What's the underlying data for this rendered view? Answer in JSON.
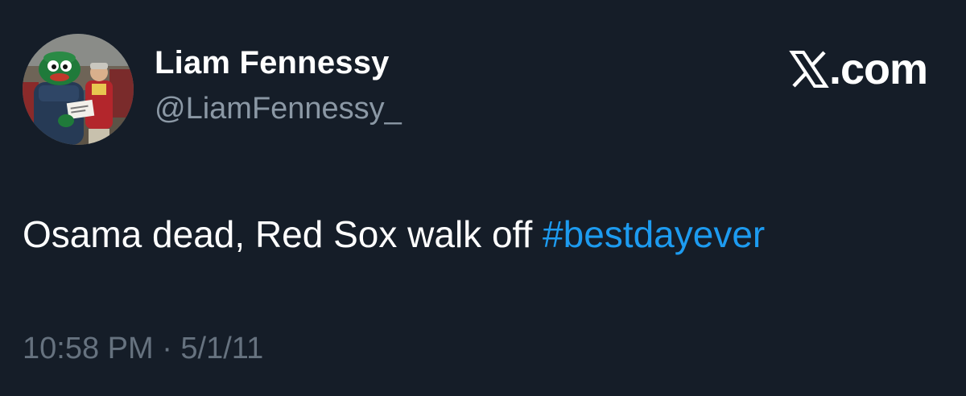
{
  "author": {
    "display_name": "Liam Fennessy",
    "handle": "@LiamFennessy_",
    "avatar": "profile-photo-mascot"
  },
  "brand": {
    "icon": "x-logo-icon",
    "domain": ".com"
  },
  "tweet": {
    "text": "Osama dead, Red Sox walk off ",
    "hashtag": "#bestdayever"
  },
  "meta": {
    "timestamp": "10:58 PM · 5/1/11"
  },
  "colors": {
    "background": "#151d28",
    "primary_text": "#ffffff",
    "secondary_text": "#8b98a5",
    "timestamp_text": "#66727f",
    "link": "#1d9bf0"
  }
}
